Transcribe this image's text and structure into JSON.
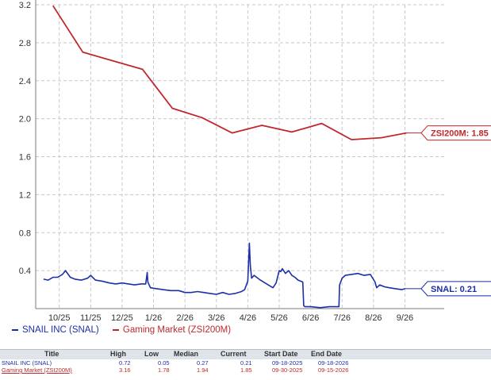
{
  "chart_data": {
    "type": "line",
    "y_ticks": [
      "3.2",
      "2.8",
      "2.4",
      "2.0",
      "1.6",
      "1.2",
      "0.8",
      "0.4"
    ],
    "y_tick_values": [
      3.2,
      2.8,
      2.4,
      2.0,
      1.6,
      1.2,
      0.8,
      0.4
    ],
    "ylim": [
      0.0,
      3.2
    ],
    "x_ticks": [
      "10/25",
      "11/25",
      "12/25",
      "1/26",
      "2/26",
      "3/26",
      "4/26",
      "5/26",
      "6/26",
      "7/26",
      "8/26",
      "9/26"
    ],
    "x_range": [
      -0.75,
      12.25
    ],
    "grid": true,
    "legend_position": "bottom-left",
    "series": [
      {
        "name": "SNAIL INC (SNAL)",
        "color": "#1c2fa8",
        "end_label": "SNAL: 0.21",
        "x": [
          -0.5,
          -0.35,
          -0.2,
          -0.05,
          0.1,
          0.2,
          0.35,
          0.5,
          0.7,
          0.9,
          1.0,
          1.15,
          1.35,
          1.6,
          1.8,
          2.0,
          2.2,
          2.4,
          2.6,
          2.75,
          2.8,
          2.82,
          2.86,
          2.9,
          3.1,
          3.3,
          3.55,
          3.8,
          4.0,
          4.2,
          4.4,
          4.6,
          4.8,
          5.0,
          5.2,
          5.4,
          5.6,
          5.8,
          5.9,
          6.0,
          6.05,
          6.08,
          6.12,
          6.2,
          6.4,
          6.6,
          6.8,
          6.9,
          7.0,
          7.05,
          7.1,
          7.2,
          7.3,
          7.4,
          7.5,
          7.6,
          7.75,
          7.78,
          7.82,
          8.0,
          8.3,
          8.6,
          8.9,
          8.92,
          9.0,
          9.1,
          9.3,
          9.5,
          9.7,
          9.9,
          10.05,
          10.1,
          10.2,
          10.35,
          10.5,
          10.7,
          10.9,
          11.0
        ],
        "values": [
          0.31,
          0.3,
          0.33,
          0.33,
          0.36,
          0.4,
          0.33,
          0.31,
          0.3,
          0.32,
          0.35,
          0.3,
          0.29,
          0.27,
          0.26,
          0.27,
          0.26,
          0.25,
          0.26,
          0.26,
          0.38,
          0.28,
          0.25,
          0.22,
          0.21,
          0.2,
          0.19,
          0.19,
          0.17,
          0.17,
          0.18,
          0.17,
          0.16,
          0.15,
          0.17,
          0.15,
          0.16,
          0.18,
          0.2,
          0.29,
          0.69,
          0.45,
          0.32,
          0.35,
          0.3,
          0.26,
          0.22,
          0.27,
          0.4,
          0.39,
          0.42,
          0.37,
          0.4,
          0.35,
          0.33,
          0.3,
          0.28,
          0.03,
          0.02,
          0.02,
          0.01,
          0.02,
          0.02,
          0.25,
          0.32,
          0.35,
          0.36,
          0.37,
          0.35,
          0.36,
          0.28,
          0.22,
          0.25,
          0.23,
          0.22,
          0.21,
          0.2,
          0.21
        ]
      },
      {
        "name": "Gaming Market (ZSI200M)",
        "color": "#c0282d",
        "end_label": "ZSI200M: 1.85",
        "x": [
          -0.2,
          0.75,
          1.7,
          2.65,
          3.6,
          4.55,
          5.5,
          6.45,
          7.4,
          8.35,
          9.3,
          10.25,
          11.05
        ],
        "values": [
          3.19,
          2.7,
          2.61,
          2.52,
          2.11,
          2.01,
          1.85,
          1.93,
          1.86,
          1.95,
          1.78,
          1.8,
          1.85
        ]
      }
    ]
  },
  "legend": [
    {
      "label": "SNAIL INC (SNAL)",
      "color": "#1c2fa8"
    },
    {
      "label": "Gaming Market (ZSI200M)",
      "color": "#c0282d"
    }
  ],
  "stats_table": {
    "headers": {
      "title": "Title",
      "high": "High",
      "low": "Low",
      "median": "Median",
      "current": "Current",
      "start_date": "Start Date",
      "end_date": "End Date"
    },
    "rows": [
      {
        "title": "SNAIL INC (SNAL)",
        "high": "0.72",
        "low": "0.05",
        "median": "0.27",
        "current": "0.21",
        "start_date": "09-18-2025",
        "end_date": "09-18-2026"
      },
      {
        "title": "Gaming Market (ZSI200M)",
        "high": "3.16",
        "low": "1.78",
        "median": "1.94",
        "current": "1.85",
        "start_date": "09-30-2025",
        "end_date": "09-15-2026"
      }
    ]
  }
}
